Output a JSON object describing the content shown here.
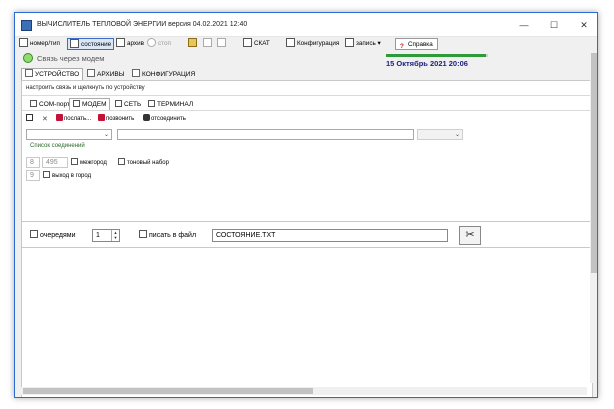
{
  "window": {
    "title": "ВЫЧИСЛИТЕЛЬ ТЕПЛОВОЙ ЭНЕРГИИ версия 04.02.2021 12:40",
    "controls": {
      "minimize": "—",
      "maximize": "☐",
      "close": "✕"
    }
  },
  "toolbar": {
    "items": [
      {
        "label": "номер/тип",
        "icon": "device-icon",
        "state": "normal"
      },
      {
        "label": "состояние",
        "icon": "status-icon",
        "state": "pressed"
      },
      {
        "label": "архив",
        "icon": "archive-icon",
        "state": "normal"
      },
      {
        "label": "стоп",
        "icon": "stop-icon",
        "state": "disabled"
      },
      {
        "label": "",
        "icon": "open-folder-icon",
        "state": "normal"
      },
      {
        "label": "",
        "icon": "save-icon",
        "state": "disabled"
      },
      {
        "label": "",
        "icon": "tools-icon",
        "state": "disabled"
      },
      {
        "label": "СКАТ",
        "icon": "skat-icon",
        "state": "normal"
      },
      {
        "label": "Конфигурация",
        "icon": "config-icon",
        "state": "normal"
      },
      {
        "label": "запись",
        "icon": "record-icon",
        "state": "normal",
        "dropdown": "▾"
      },
      {
        "label": "Справка",
        "icon": "help-icon",
        "state": "help",
        "glyph": "?"
      }
    ]
  },
  "status": {
    "text": "Связь через модем",
    "progress": 0.98,
    "datetime": "15 Октябрь 2021  20:06",
    "indicator_color": "#8fdc6e"
  },
  "main_tabs": [
    {
      "label": "УСТРОЙСТВО",
      "icon": "device-tab-icon",
      "active": true
    },
    {
      "label": "АРХИВЫ",
      "icon": "archive-tab-icon",
      "active": false
    },
    {
      "label": "КОНФИГУРАЦИЯ",
      "icon": "config-tab-icon",
      "active": false
    }
  ],
  "hint": "настроить связь и щелкнуть по устройству",
  "sub_tabs": [
    {
      "label": "COM-порт",
      "icon": "com-port-icon",
      "active": false
    },
    {
      "label": "МОДЕМ",
      "icon": "phone-icon",
      "active": true
    },
    {
      "label": "СЕТЬ",
      "icon": "network-icon",
      "active": false
    },
    {
      "label": "ТЕРМИНАЛ",
      "icon": "terminal-icon",
      "active": false
    }
  ],
  "actions": [
    {
      "label": "",
      "icon": "save-icon"
    },
    {
      "label": "",
      "icon": "delete-icon",
      "glyph": "✕"
    },
    {
      "label": "послать...",
      "icon": "send-icon"
    },
    {
      "label": "позвонить",
      "icon": "dial-icon"
    },
    {
      "label": "отсоединить",
      "icon": "hangup-icon"
    }
  ],
  "modem": {
    "connection_list_label": "Список соединений",
    "country_code": "8",
    "area_code": "495",
    "intercity_label": "межгород",
    "tone_dial_label": "тоновый набор",
    "exit_code": "9",
    "city_exit_label": "выход в город"
  },
  "bottom": {
    "queue_label": "очередями",
    "queue_value": "1",
    "spin_up": "▲",
    "spin_down": "▼",
    "write_file_label": "писать в файл",
    "filename": "СОСТОЯНИЕ.TXT",
    "tools_glyph": "✂"
  },
  "colors": {
    "accent": "#2b6cd4",
    "datetime": "#1a237e",
    "progress": "#2f9a3a",
    "link": "#2a6a2a"
  }
}
